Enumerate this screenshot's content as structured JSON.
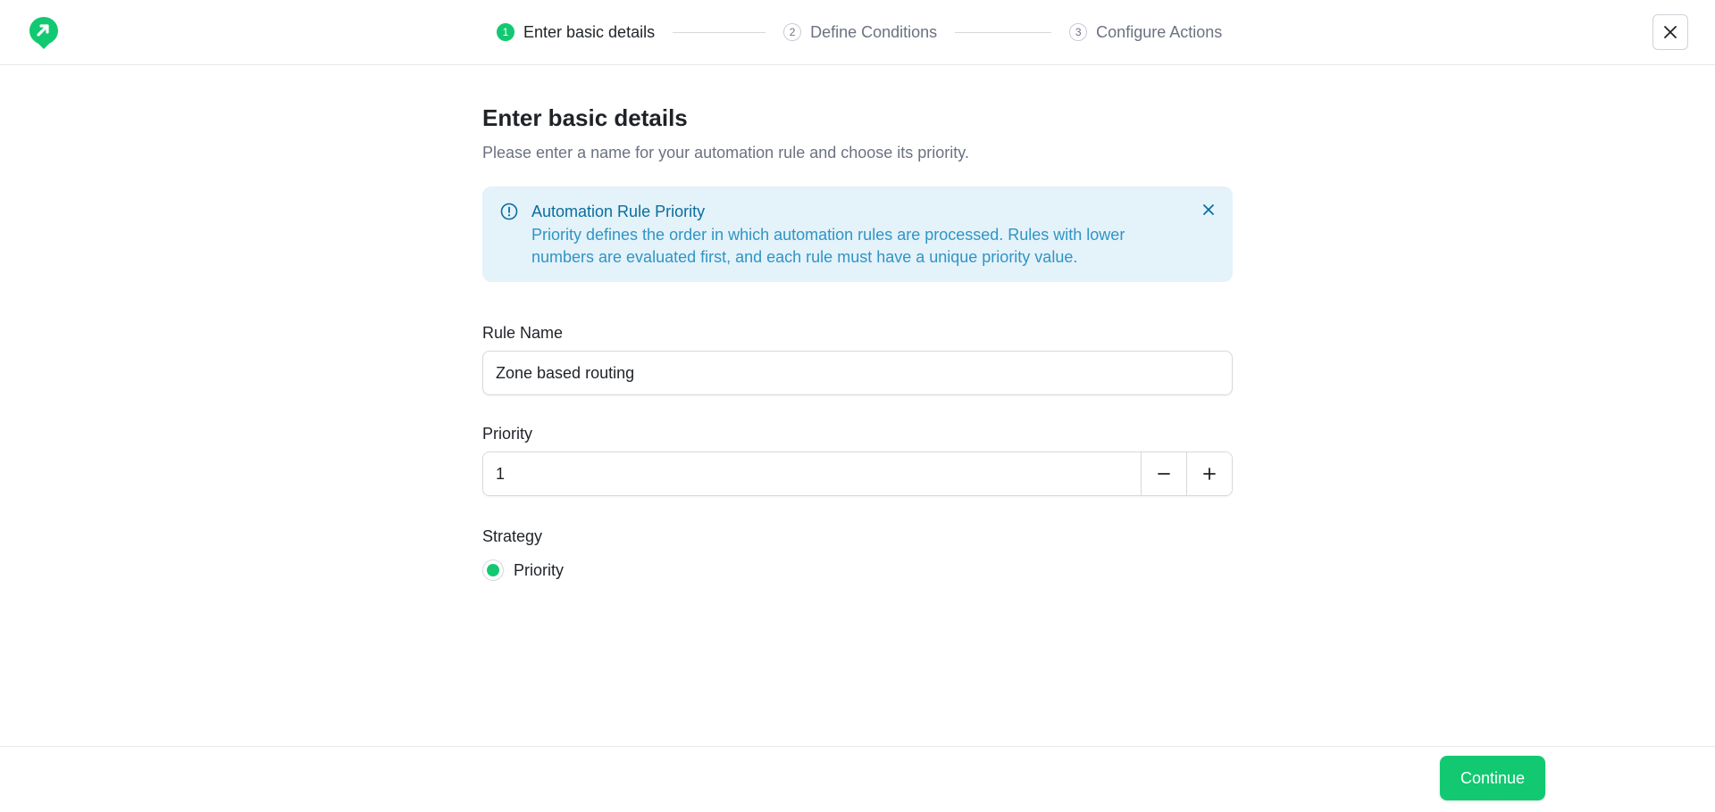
{
  "header": {
    "steps": [
      {
        "number": "1",
        "label": "Enter basic details",
        "active": true
      },
      {
        "number": "2",
        "label": "Define Conditions",
        "active": false
      },
      {
        "number": "3",
        "label": "Configure Actions",
        "active": false
      }
    ],
    "close_icon": "close-icon",
    "logo_icon": "brand-logo-icon"
  },
  "main": {
    "title": "Enter basic details",
    "subtitle": "Please enter a name for your automation rule and choose its priority.",
    "alert": {
      "title": "Automation Rule Priority",
      "body": "Priority defines the order in which automation rules are processed. Rules with lower numbers are evaluated first, and each rule must have a unique priority value.",
      "icon": "info-icon"
    },
    "rule_name": {
      "label": "Rule Name",
      "value": "Zone based routing"
    },
    "priority": {
      "label": "Priority",
      "value": "1"
    },
    "strategy": {
      "label": "Strategy",
      "option": "Priority",
      "selected": true
    }
  },
  "footer": {
    "continue_label": "Continue"
  },
  "colors": {
    "accent": "#12c971",
    "alert_bg": "#e4f2fa",
    "alert_title": "#0a6e9c",
    "alert_text": "#2f95c4"
  }
}
